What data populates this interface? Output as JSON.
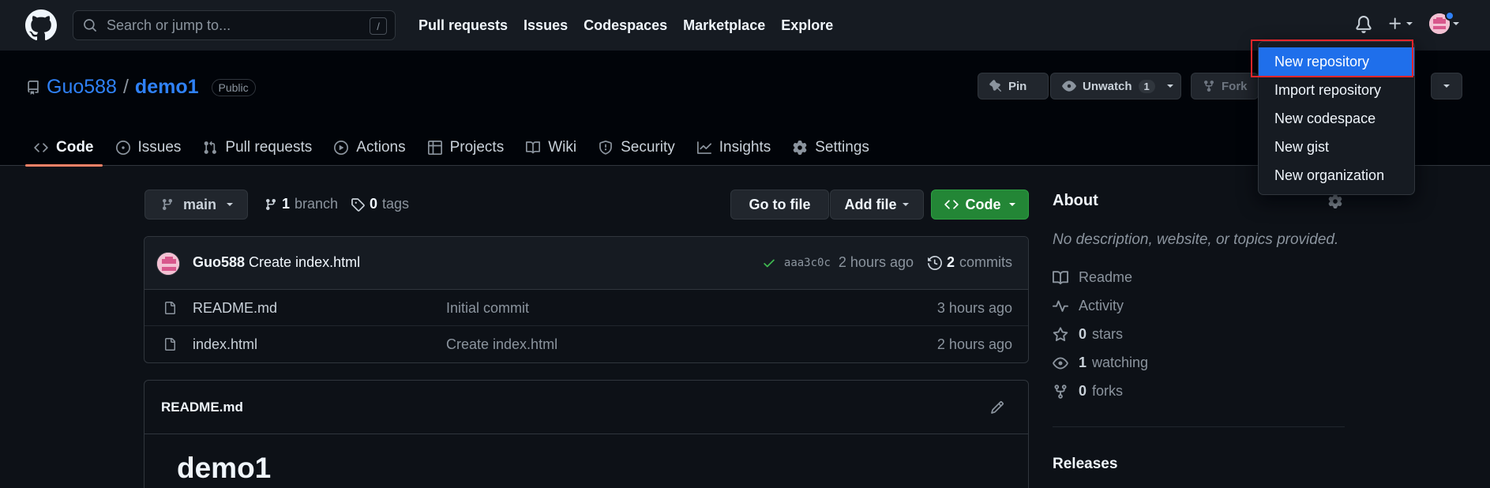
{
  "header": {
    "search_placeholder": "Search or jump to...",
    "search_shortcut": "/",
    "nav": [
      "Pull requests",
      "Issues",
      "Codespaces",
      "Marketplace",
      "Explore"
    ]
  },
  "repo": {
    "owner": "Guo588",
    "separator": "/",
    "name": "demo1",
    "visibility": "Public",
    "pin_label": "Pin",
    "unwatch_label": "Unwatch",
    "watch_count": "1",
    "fork_label": "Fork"
  },
  "tabs": [
    {
      "label": "Code",
      "icon": "code-icon"
    },
    {
      "label": "Issues",
      "icon": "issue-icon"
    },
    {
      "label": "Pull requests",
      "icon": "pull-request-icon"
    },
    {
      "label": "Actions",
      "icon": "play-icon"
    },
    {
      "label": "Projects",
      "icon": "table-icon"
    },
    {
      "label": "Wiki",
      "icon": "book-icon"
    },
    {
      "label": "Security",
      "icon": "shield-icon"
    },
    {
      "label": "Insights",
      "icon": "graph-icon"
    },
    {
      "label": "Settings",
      "icon": "gear-icon"
    }
  ],
  "toolbar": {
    "branch": "main",
    "branch_count": "1",
    "branch_word": "branch",
    "tag_count": "0",
    "tag_word": "tags",
    "go_to_file": "Go to file",
    "add_file": "Add file",
    "code": "Code"
  },
  "latest_commit": {
    "author": "Guo588",
    "message": "Create index.html",
    "sha": "aaa3c0c",
    "time": "2 hours ago",
    "commit_count": "2",
    "commit_word": "commits"
  },
  "files": [
    {
      "name": "README.md",
      "message": "Initial commit",
      "age": "3 hours ago"
    },
    {
      "name": "index.html",
      "message": "Create index.html",
      "age": "2 hours ago"
    }
  ],
  "readme": {
    "title": "README.md",
    "heading": "demo1"
  },
  "about": {
    "title": "About",
    "description": "No description, website, or topics provided.",
    "readme": "Readme",
    "activity": "Activity",
    "stars_count": "0",
    "stars_word": "stars",
    "watching_count": "1",
    "watching_word": "watching",
    "forks_count": "0",
    "forks_word": "forks",
    "releases": "Releases"
  },
  "create_menu": {
    "items": [
      "New repository",
      "Import repository",
      "New codespace",
      "New gist",
      "New organization"
    ],
    "highlighted": "New repository"
  },
  "colors": {
    "accent": "#2f81f7",
    "primary_button": "#238636",
    "menu_highlight": "#1f6feb",
    "tab_underline": "#f78166",
    "annotation_box": "#e5252a"
  }
}
